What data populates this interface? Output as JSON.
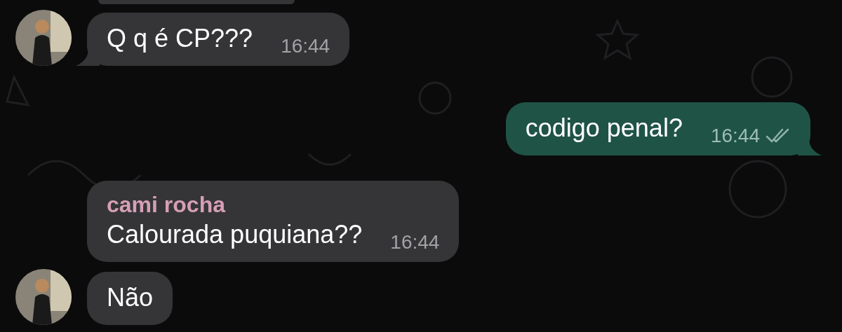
{
  "messages": [
    {
      "kind": "fragment"
    },
    {
      "kind": "incoming",
      "text": "Q q é CP???",
      "time": "16:44",
      "avatar": true,
      "tail": true
    },
    {
      "kind": "outgoing",
      "text": "codigo penal?",
      "time": "16:44",
      "tail": true
    },
    {
      "kind": "incoming",
      "sender": "cami rocha",
      "text": "Calourada puquiana??",
      "time": "16:44",
      "avatar": false,
      "tail": false
    },
    {
      "kind": "incoming",
      "text": "Não",
      "avatar": true,
      "tail": false
    }
  ]
}
